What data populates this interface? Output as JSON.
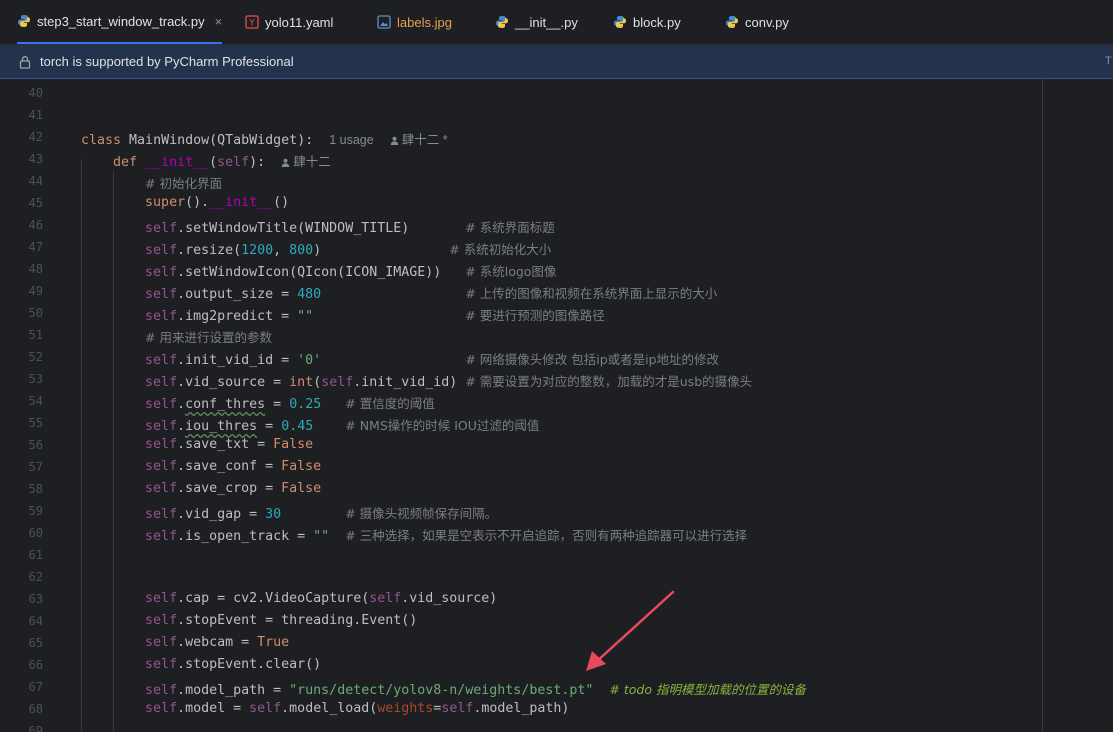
{
  "tabs": [
    {
      "label": "step3_start_window_track.py",
      "icon": "python-file-icon",
      "active": true,
      "close": "×"
    },
    {
      "label": "yolo11.yaml",
      "icon": "yaml-file-icon",
      "active": false
    },
    {
      "label": "labels.jpg",
      "icon": "image-file-icon",
      "active": false
    },
    {
      "label": "__init__.py",
      "icon": "python-file-icon",
      "active": false
    },
    {
      "label": "block.py",
      "icon": "python-file-icon",
      "active": false
    },
    {
      "label": "conv.py",
      "icon": "python-file-icon",
      "active": false
    }
  ],
  "banner": {
    "text": "torch is supported by PyCharm Professional",
    "icon": "lock-icon",
    "more": "T"
  },
  "editor": {
    "line_numbers": [
      "40",
      "41",
      "42",
      "43",
      "44",
      "45",
      "46",
      "47",
      "48",
      "49",
      "50",
      "51",
      "52",
      "53",
      "54",
      "55",
      "56",
      "57",
      "58",
      "59",
      "60",
      "61",
      "62",
      "63",
      "64",
      "65",
      "66",
      "67",
      "68",
      "69"
    ],
    "class_name": "MainWindow",
    "base_class": "QTabWidget",
    "usage_hint": "1 usage",
    "author_hint": "肆十二 *",
    "init_author_hint": "肆十二",
    "comments": {
      "l44": "# 初始化界面",
      "l46": "# 系统界面标题",
      "l47": "# 系统初始化大小",
      "l48": "# 系统logo图像",
      "l49": "# 上传的图像和视频在系统界面上显示的大小",
      "l50": "# 要进行预测的图像路径",
      "l51": "# 用来进行设置的参数",
      "l52": "# 网络摄像头修改 包括ip或者是ip地址的修改",
      "l53": "# 需要设置为对应的整数，加载的才是usb的摄像头",
      "l54": "# 置信度的阈值",
      "l55": "# NMS操作的时候 IOU过滤的阈值",
      "l59": "# 摄像头视频帧保存间隔。",
      "l60": "# 三种选择，如果是空表示不开启追踪，否则有两种追踪器可以进行选择",
      "l67": "# todo 指明模型加载的位置的设备"
    },
    "values": {
      "resize_w": "1200",
      "resize_h": "800",
      "output_size": "480",
      "img2predict": "\"\"",
      "init_vid_id": "'0'",
      "conf_thres": "0.25",
      "iou_thres": "0.45",
      "save_txt": "False",
      "save_conf": "False",
      "save_crop": "False",
      "vid_gap": "30",
      "is_open_track": "\"\"",
      "webcam": "True",
      "model_path": "\"runs/detect/yolov8-n/weights/best.pt\""
    }
  },
  "colors": {
    "accent": "#3574f0",
    "annotation_arrow": "#e8495f",
    "background": "#1e1f22"
  }
}
